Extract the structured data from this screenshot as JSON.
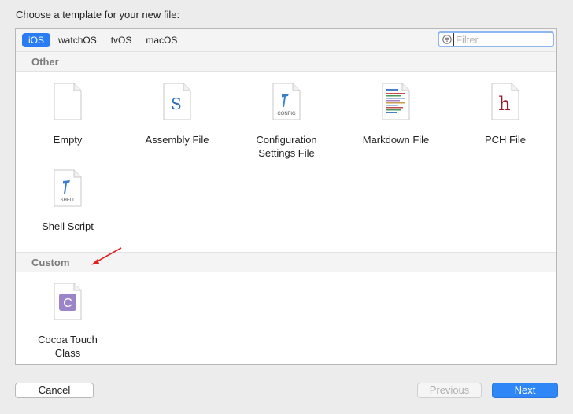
{
  "heading": "Choose a template for your new file:",
  "tabs": [
    {
      "label": "iOS",
      "active": true
    },
    {
      "label": "watchOS",
      "active": false
    },
    {
      "label": "tvOS",
      "active": false
    },
    {
      "label": "macOS",
      "active": false
    }
  ],
  "filter": {
    "placeholder": "Filter",
    "value": ""
  },
  "sections": {
    "other": {
      "title": "Other",
      "items": [
        {
          "label": "Empty",
          "icon": "empty-file-icon"
        },
        {
          "label": "Assembly File",
          "icon": "assembly-file-icon",
          "glyph": "S"
        },
        {
          "label": "Configuration",
          "label2": "Settings File",
          "icon": "config-file-icon",
          "caption": "CONFIG"
        },
        {
          "label": "Markdown File",
          "icon": "markdown-file-icon"
        },
        {
          "label": "PCH File",
          "icon": "pch-file-icon",
          "glyph": "h"
        },
        {
          "label": "Shell Script",
          "icon": "shell-script-icon",
          "caption": "SHELL"
        }
      ]
    },
    "custom": {
      "title": "Custom",
      "items": [
        {
          "label": "Cocoa Touch",
          "label2": "Class",
          "icon": "cocoa-touch-class-icon",
          "glyph": "C"
        }
      ]
    }
  },
  "buttons": {
    "cancel": "Cancel",
    "previous": "Previous",
    "next": "Next"
  },
  "colors": {
    "accent": "#2a7cf2",
    "annotation_arrow": "#e0201c",
    "class_badge": "#9b84c7"
  }
}
